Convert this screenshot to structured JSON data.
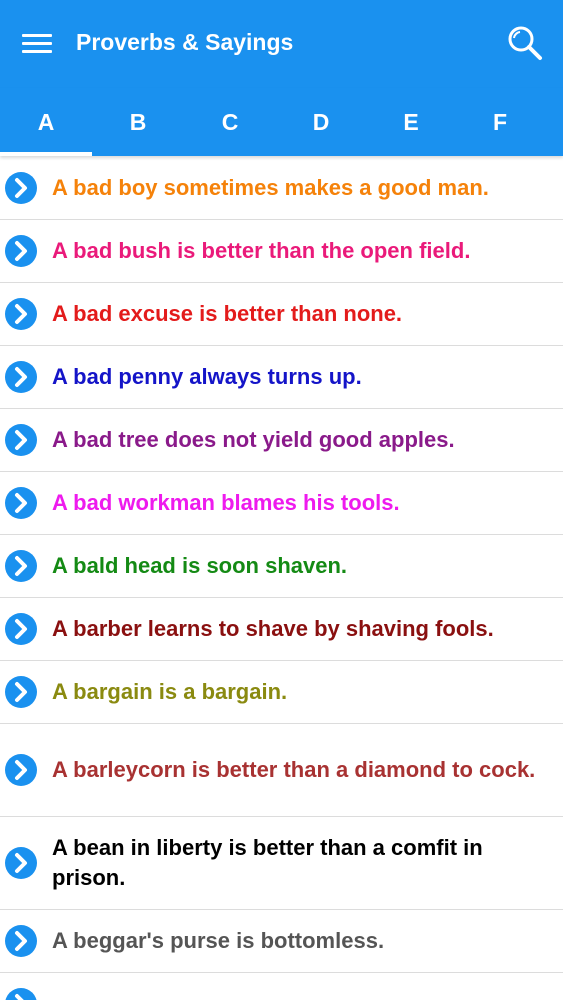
{
  "header": {
    "title": "Proverbs & Sayings"
  },
  "tabs": [
    "A",
    "B",
    "C",
    "D",
    "E",
    "F"
  ],
  "colors": {
    "primary": "#1a91ef",
    "chevron": "#1a91ef"
  },
  "proverbs": [
    {
      "text": "A bad boy sometimes makes a good man.",
      "color": "#f5820a"
    },
    {
      "text": "A bad bush is better than the open field.",
      "color": "#ea1a7a"
    },
    {
      "text": "A bad excuse is better than none.",
      "color": "#e31b1b"
    },
    {
      "text": "A bad penny always turns up.",
      "color": "#1414c8"
    },
    {
      "text": "A bad tree does not yield good apples.",
      "color": "#8a1a8a"
    },
    {
      "text": "A bad workman blames his tools.",
      "color": "#ee1aee"
    },
    {
      "text": "A bald head is soon shaven.",
      "color": "#148a14"
    },
    {
      "text": "A barber learns to shave by shaving fools.",
      "color": "#8a1010"
    },
    {
      "text": "A bargain is a bargain.",
      "color": "#8a8a10"
    },
    {
      "text": "A barleycorn is better than a diamond to cock.",
      "color": "#a83232"
    },
    {
      "text": "A bean in liberty is better than a comfit in prison.",
      "color": "#000000"
    },
    {
      "text": "A beggar's purse is bottomless.",
      "color": "#555555"
    },
    {
      "text": "",
      "color": "#f5820a"
    }
  ]
}
